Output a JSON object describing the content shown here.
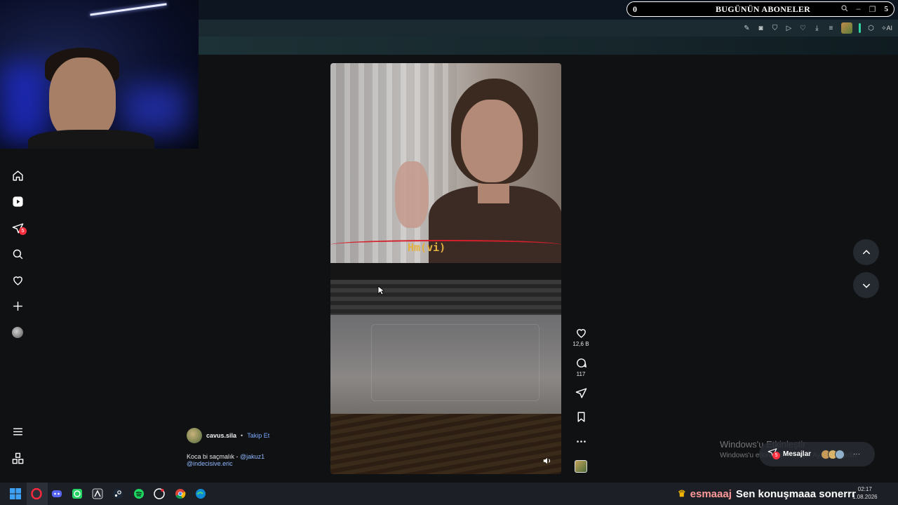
{
  "banner": {
    "count": "0",
    "title": "BUGÜNÜN ABONELER",
    "right_number": "5"
  },
  "toolbar": {
    "ai_label": "AI"
  },
  "nav": {
    "notification_badge": "5"
  },
  "reel": {
    "caption_overlay": "Hm(vi)",
    "likes": "12,6 B",
    "comments": "117"
  },
  "post": {
    "username": "cavus.sila",
    "separator": "•",
    "follow_label": "Takip Et",
    "caption_text": "Koca bi saçmalık - ",
    "mention1": "@jakuz1",
    "mention2": "@indecisive.eric"
  },
  "watermark": {
    "line1": "Windows'u Etkinleştir",
    "line2": "Windows'u etkinleştirmek için Ayarlar'a gidin."
  },
  "messages": {
    "label": "Mesajlar",
    "badge": "5",
    "more": "···"
  },
  "chat": {
    "username": "esmaaaj",
    "message": "Sen konuşmaaa sonerrr"
  },
  "clock": {
    "time": "02:17",
    "date": "1.08.2026"
  },
  "colors": {
    "accent": "#2dd4a0",
    "badge": "#ff3040",
    "link": "#7aa9ff",
    "chat_user": "#ff9a9a"
  }
}
